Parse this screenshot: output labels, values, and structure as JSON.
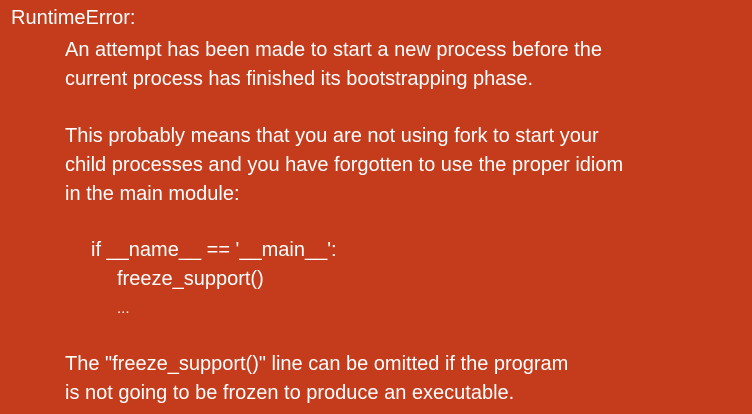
{
  "error": {
    "title": "RuntimeError:",
    "paragraph1": [
      "An attempt has been made to start a new process before the",
      "current process has finished its bootstrapping phase."
    ],
    "paragraph2": [
      "This probably means that you are not using fork to start your",
      "child processes and you have forgotten to use the proper idiom",
      "in the main module:"
    ],
    "code": {
      "line1": "if __name__ == '__main__':",
      "line2": "freeze_support()",
      "line3": "..."
    },
    "paragraph3": [
      "The \"freeze_support()\" line can be omitted if the program",
      "is not going to be frozen to produce an executable."
    ]
  },
  "colors": {
    "background": "#c43c1c",
    "text": "#ffffff"
  }
}
